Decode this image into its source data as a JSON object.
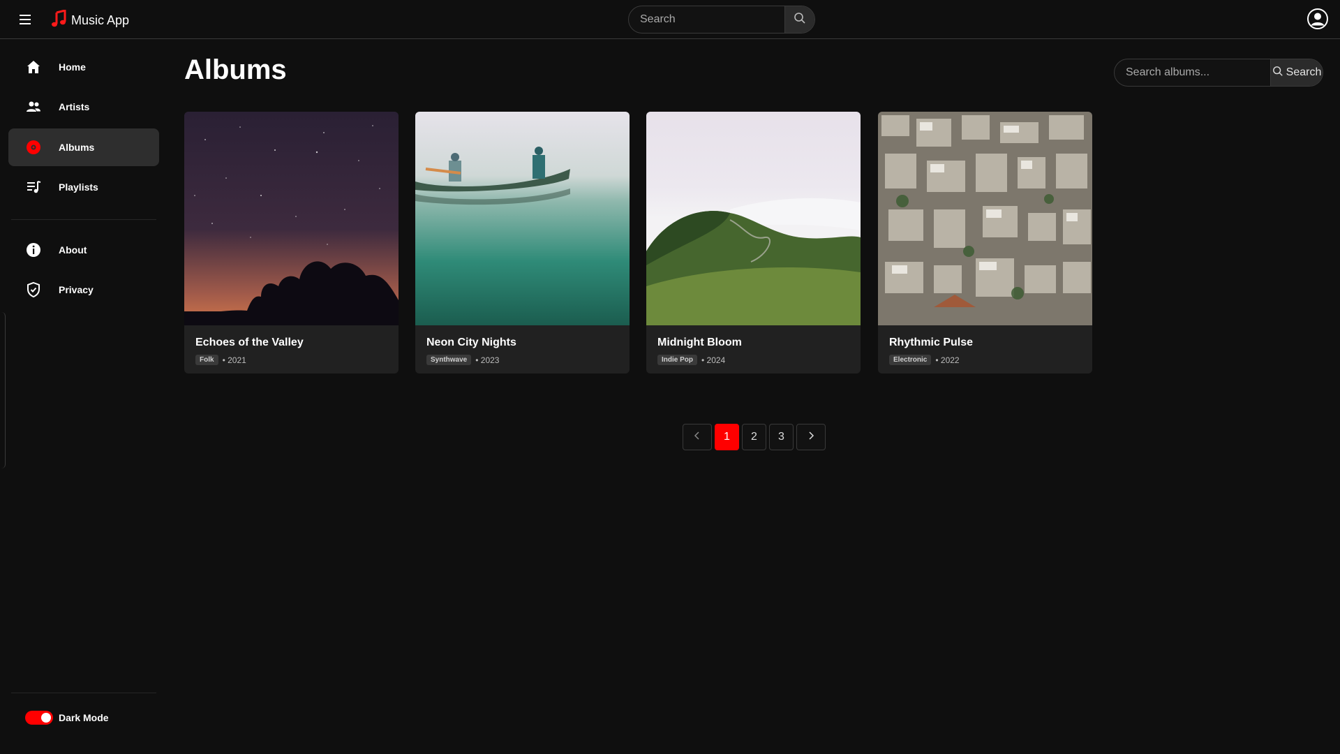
{
  "app": {
    "title": "Music App",
    "accent": "#ff0000"
  },
  "topbar": {
    "search_placeholder": "Search"
  },
  "sidebar": {
    "items": [
      {
        "label": "Home",
        "icon": "home-icon",
        "active": false
      },
      {
        "label": "Artists",
        "icon": "artists-icon",
        "active": false
      },
      {
        "label": "Albums",
        "icon": "album-disc-icon",
        "active": true
      },
      {
        "label": "Playlists",
        "icon": "playlist-icon",
        "active": false
      },
      {
        "label": "About",
        "icon": "info-icon",
        "active": false
      },
      {
        "label": "Privacy",
        "icon": "shield-icon",
        "active": false
      }
    ],
    "dark_mode_label": "Dark Mode",
    "dark_mode_on": true
  },
  "main": {
    "title": "Albums",
    "search_placeholder": "Search albums...",
    "search_button": "Search",
    "albums": [
      {
        "title": "Echoes of the Valley",
        "genre": "Folk",
        "year": "• 2021",
        "art": "starry night sky silhouette"
      },
      {
        "title": "Neon City Nights",
        "genre": "Synthwave",
        "year": "• 2023",
        "art": "canoe on misty lake"
      },
      {
        "title": "Midnight Bloom",
        "genre": "Indie Pop",
        "year": "• 2024",
        "art": "green hills above clouds"
      },
      {
        "title": "Rhythmic Pulse",
        "genre": "Electronic",
        "year": "• 2022",
        "art": "aerial city rooftops"
      }
    ],
    "pagination": {
      "pages": [
        "1",
        "2",
        "3"
      ],
      "current": "1"
    }
  }
}
